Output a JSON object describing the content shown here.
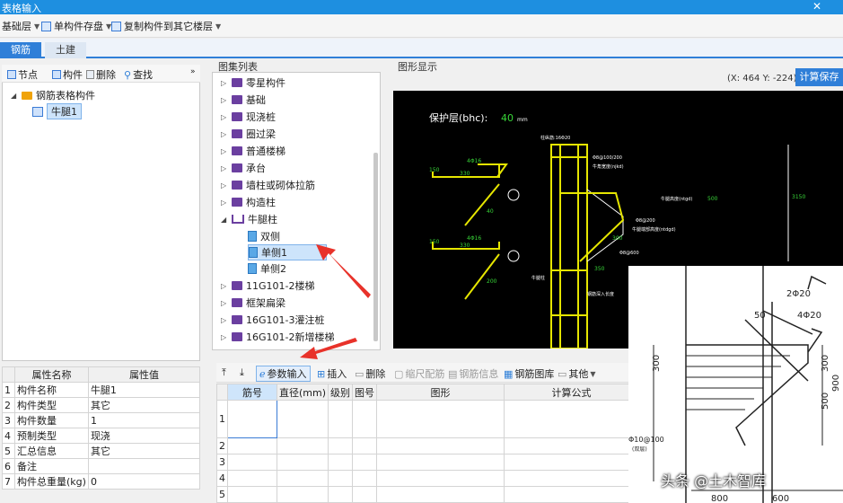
{
  "window": {
    "title": "表格输入",
    "close_glyph": "✕"
  },
  "toolbar": {
    "floor": "基础层",
    "save_component": "单构件存盘",
    "copy_to_floors": "复制构件到其它楼层"
  },
  "tabs": {
    "rebar": "钢筋",
    "civil": "土建"
  },
  "left_tools": {
    "node": "节点",
    "component": "构件",
    "delete": "删除",
    "find": "查找"
  },
  "tree": {
    "root": "钢筋表格构件",
    "child": "牛腿1"
  },
  "atlas": {
    "heading": "图集列表",
    "items": [
      {
        "label": "零星构件"
      },
      {
        "label": "基础"
      },
      {
        "label": "现浇桩"
      },
      {
        "label": "圈过梁"
      },
      {
        "label": "普通楼梯"
      },
      {
        "label": "承台"
      },
      {
        "label": "墙柱或砌体拉筋"
      },
      {
        "label": "构造柱"
      },
      {
        "label": "牛腿柱"
      },
      {
        "label": "双侧"
      },
      {
        "label": "单侧1"
      },
      {
        "label": "单侧2"
      },
      {
        "label": "11G101-2楼梯"
      },
      {
        "label": "框架扁梁"
      },
      {
        "label": "16G101-3灌注桩"
      },
      {
        "label": "16G101-2新增楼梯"
      }
    ]
  },
  "graphic": {
    "heading": "图形显示",
    "coords": "(X: 464 Y: -224)",
    "calc_save": "计算保存",
    "cover_label": "保护层(bhc):",
    "cover_value": "40",
    "cover_unit": "mm",
    "labels": {
      "top_bar": "4Φ16",
      "len330": "330",
      "len150": "150",
      "len40": "40",
      "len200": "200",
      "col_top": "柱纵筋:16Φ20",
      "stirrup": "Φ8@100/200",
      "sect_h": "牛角宽度(njkd)",
      "leg_h": "牛腿高度(ntgd)",
      "leg_h_val": "500",
      "stirrup2": "Φ8@200",
      "tip_h": "牛腿端部高度(ntdgd)",
      "tip_val": "300",
      "stirrup3": "Φ8@600",
      "len350": "350",
      "anchor": "钢筋深入长度",
      "side": "3150",
      "col": "牛腿柱"
    }
  },
  "props": {
    "header_name": "属性名称",
    "header_value": "属性值",
    "rows": [
      {
        "no": "1",
        "name": "构件名称",
        "value": "牛腿1"
      },
      {
        "no": "2",
        "name": "构件类型",
        "value": "其它"
      },
      {
        "no": "3",
        "name": "构件数量",
        "value": "1"
      },
      {
        "no": "4",
        "name": "预制类型",
        "value": "现浇"
      },
      {
        "no": "5",
        "name": "汇总信息",
        "value": "其它"
      },
      {
        "no": "6",
        "name": "备注",
        "value": ""
      },
      {
        "no": "7",
        "name": "构件总重量(kg)",
        "value": "0"
      }
    ]
  },
  "grid_tools": {
    "param_input": "参数输入",
    "insert": "插入",
    "delete": "删除",
    "scale_config": "缩尺配筋",
    "rebar_info": "钢筋信息",
    "rebar_lib": "钢筋图库",
    "other": "其他"
  },
  "rebar_table": {
    "headers": [
      "筋号",
      "直径(mm)",
      "级别",
      "图号",
      "图形",
      "计算公式"
    ],
    "rows": [
      "1",
      "2",
      "3",
      "4",
      "5"
    ]
  },
  "overlay": {
    "d1": "2Φ20",
    "d2": "4Φ20",
    "d3": "50",
    "d4": "300",
    "d5": "300",
    "d6": "500",
    "d7": "900",
    "d8": "Φ10@100",
    "d9": "(双层)",
    "d10": "800",
    "d11": "600"
  },
  "watermark": "头条 @土木智库"
}
